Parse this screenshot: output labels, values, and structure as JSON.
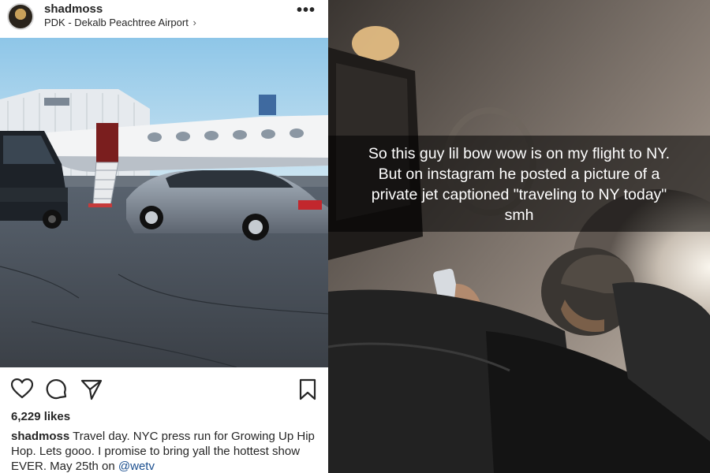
{
  "instagram": {
    "username": "shadmoss",
    "location": "PDK - Dekalb Peachtree Airport",
    "location_chevron": "›",
    "more_label": "•••",
    "likes": "6,229 likes",
    "caption_user": "shadmoss",
    "caption_text": " Travel day. NYC press run for Growing Up Hip Hop. Lets gooo. I promise to bring yall the hottest show EVER. May 25th on ",
    "caption_mention": "@wetv",
    "icons": [
      "heart-icon",
      "comment-icon",
      "share-icon",
      "bookmark-icon"
    ]
  },
  "snapchat": {
    "caption_line1": "So this guy lil bow wow is on my flight to NY.",
    "caption_line2": "But on instagram he posted a picture of a",
    "caption_line3": "private jet captioned \"traveling to NY today\"",
    "caption_line4": "smh"
  }
}
